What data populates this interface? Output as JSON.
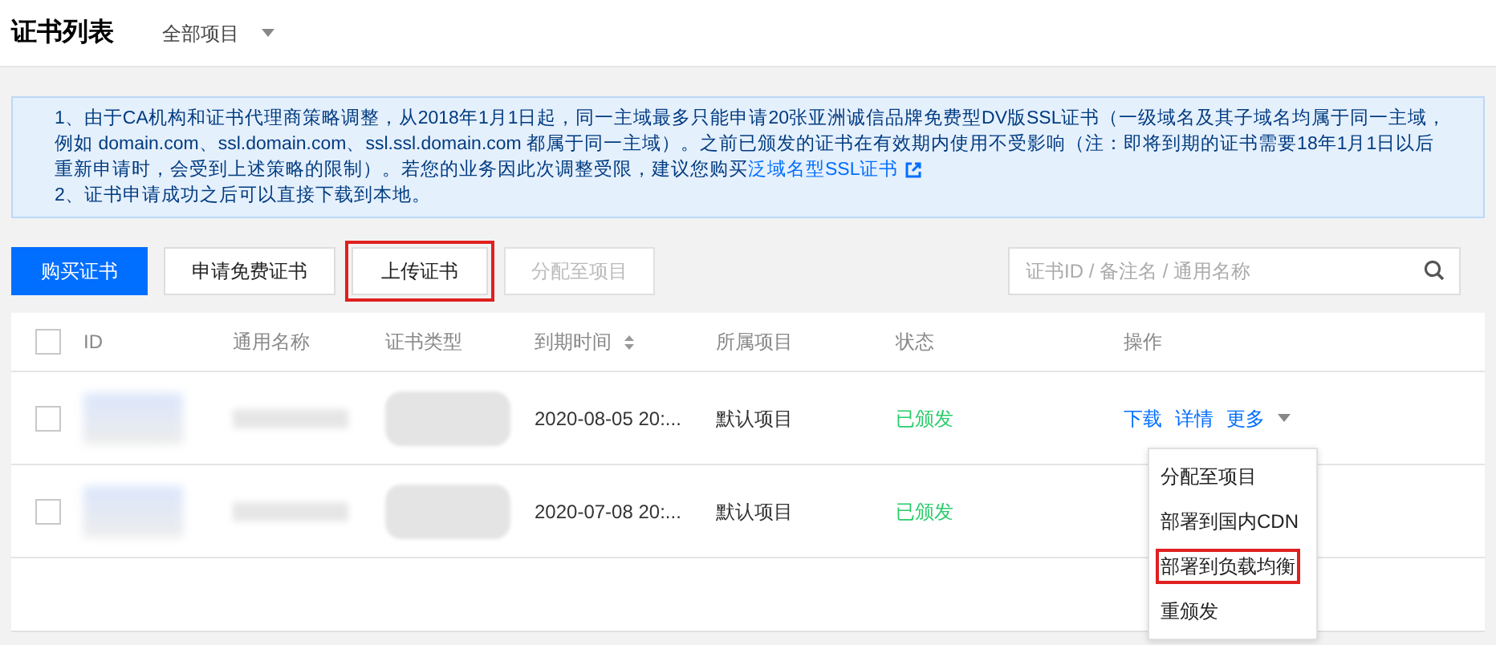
{
  "header": {
    "title": "证书列表",
    "project_filter": "全部项目"
  },
  "notice": {
    "items": [
      {
        "text": "1、由于CA机构和证书代理商策略调整，从2018年1月1日起，同一主域最多只能申请20张亚洲诚信品牌免费型DV版SSL证书（一级域名及其子域名均属于同一主域，例如 domain.com、ssl.domain.com、ssl.ssl.domain.com 都属于同一主域）。之前已颁发的证书在有效期内使用不受影响（注：即将到期的证书需要18年1月1日以后重新申请时，会受到上述策略的限制）。若您的业务因此次调整受限，建议您购买",
        "link": "泛域名型SSL证书"
      },
      {
        "text": "2、证书申请成功之后可以直接下载到本地。"
      }
    ]
  },
  "toolbar": {
    "buttons": [
      {
        "label": "购买证书",
        "kind": "primary",
        "disabled": false,
        "highlighted": false
      },
      {
        "label": "申请免费证书",
        "kind": "default",
        "disabled": false,
        "highlighted": false
      },
      {
        "label": "上传证书",
        "kind": "default",
        "disabled": false,
        "highlighted": true
      },
      {
        "label": "分配至项目",
        "kind": "default",
        "disabled": true,
        "highlighted": false
      }
    ],
    "search": {
      "placeholder": "证书ID / 备注名 / 通用名称"
    }
  },
  "table": {
    "select_all_checked": false,
    "columns": [
      "ID",
      "通用名称",
      "证书类型",
      "到期时间",
      "所属项目",
      "状态",
      "操作"
    ],
    "rows": [
      {
        "checked": false,
        "expiry": "2020-08-05 20:...",
        "project": "默认项目",
        "status": "已颁发",
        "actions": [
          "下载",
          "详情",
          "更多"
        ]
      },
      {
        "checked": false,
        "expiry": "2020-07-08 20:...",
        "project": "默认项目",
        "status": "已颁发"
      }
    ]
  },
  "more_menu": {
    "items": [
      {
        "label": "分配至项目",
        "highlighted": false
      },
      {
        "label": "部署到国内CDN",
        "highlighted": false
      },
      {
        "label": "部署到负载均衡",
        "highlighted": true
      },
      {
        "label": "重颁发",
        "highlighted": false
      }
    ]
  }
}
